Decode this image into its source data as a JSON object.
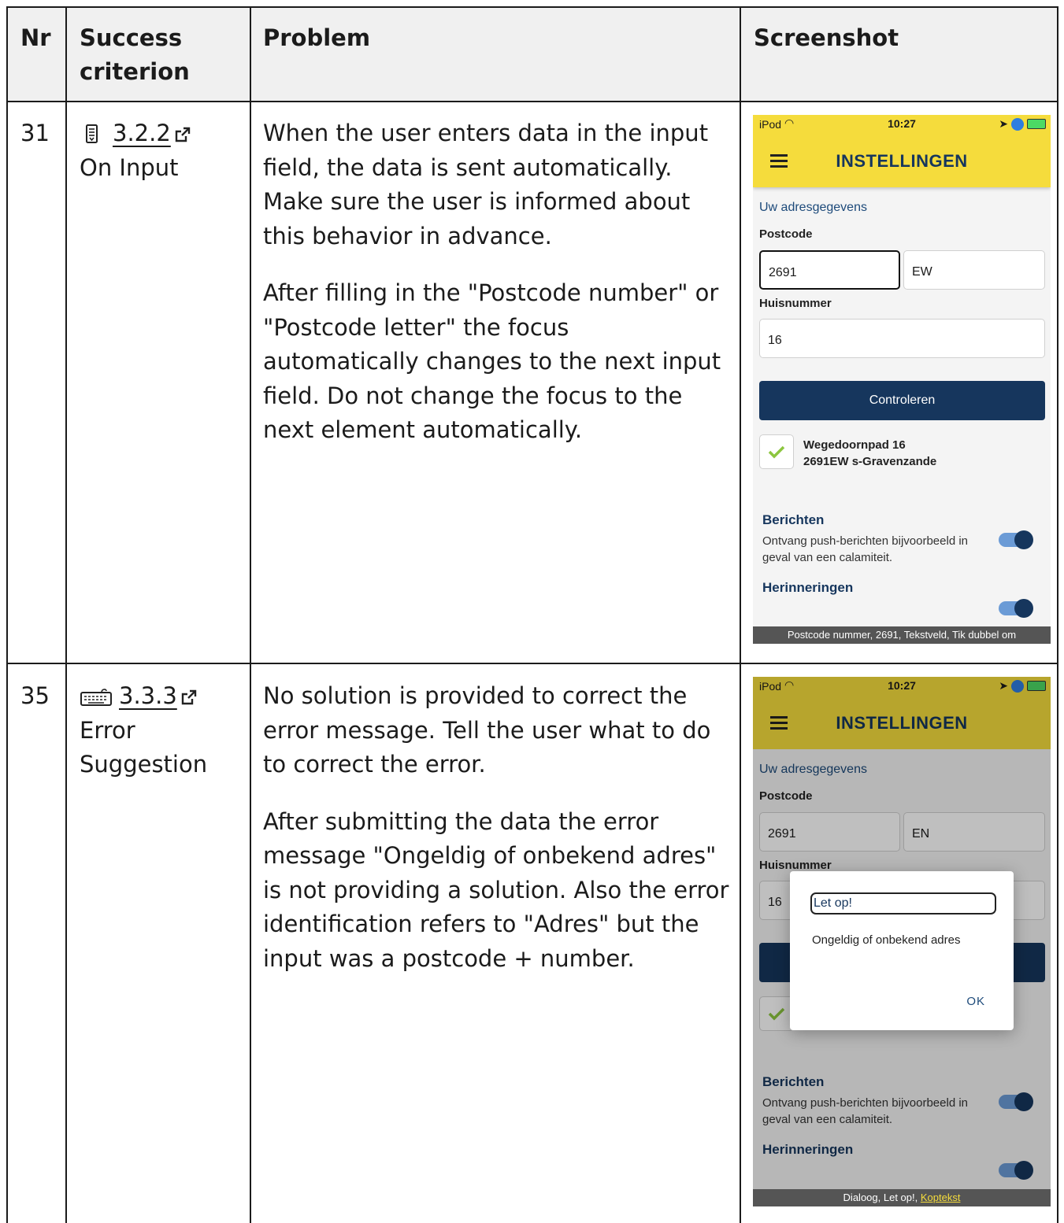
{
  "table": {
    "headers": {
      "nr": "Nr",
      "success_line1": "Success",
      "success_line2": "criterion",
      "problem": "Problem",
      "screenshot": "Screenshot"
    },
    "rows": [
      {
        "nr": "31",
        "sc_icon": "input-form-icon",
        "sc_number": "3.2.2",
        "sc_name": "On Input",
        "problem_p1": "When the user enters data in the input field, the data is sent automatically. Make sure the user is informed about this behavior in advance.",
        "problem_p2": "After filling in the \"Postcode number\" or \"Postcode letter\" the focus automatically changes to the next input field. Do not change the focus to the next element automatically."
      },
      {
        "nr": "35",
        "sc_icon": "keyboard-icon",
        "sc_number": "3.3.3",
        "sc_name_line1": "Error",
        "sc_name_line2": "Suggestion",
        "problem_p1": "No solution is provided to correct the error message. Tell the user what to do to correct the error.",
        "problem_p2": "After submitting the data the error message \"Ongeldig of onbekend adres\" is not providing a solution. Also the error identification refers to \"Adres\" but the input was a postcode + number."
      }
    ]
  },
  "phone1": {
    "carrier": "iPod",
    "time": "10:27",
    "title": "INSTELLINGEN",
    "subtitle": "Uw adresgegevens",
    "postcode_label": "Postcode",
    "postcode_number": "2691",
    "postcode_letters": "EW",
    "house_label": "Huisnummer",
    "house_number": "16",
    "button": "Controleren",
    "address_line1": "Wegedoornpad 16",
    "address_line2": "2691EW s-Gravenzande",
    "berichten_title": "Berichten",
    "berichten_text": "Ontvang push-berichten bijvoorbeeld in geval van een calamiteit.",
    "herinneringen_title": "Herinneringen",
    "voiceover": "Postcode nummer, 2691, Tekstveld, Tik dubbel om",
    "header_color": "#f5dc3c"
  },
  "phone2": {
    "carrier": "iPod",
    "time": "10:27",
    "title": "INSTELLINGEN",
    "subtitle": "Uw adresgegevens",
    "postcode_label": "Postcode",
    "postcode_number": "2691",
    "postcode_letters": "EN",
    "house_label": "Huisnummer",
    "house_number": "16",
    "dialog_title": "Let op!",
    "dialog_message": "Ongeldig of onbekend adres",
    "dialog_ok": "OK",
    "berichten_title": "Berichten",
    "berichten_text": "Ontvang push-berichten bijvoorbeeld in geval van een calamiteit.",
    "herinneringen_title": "Herinneringen",
    "voiceover_prefix": "Dialoog, Let op!, ",
    "voiceover_highlight": "Koptekst",
    "header_color": "#a6952a"
  }
}
